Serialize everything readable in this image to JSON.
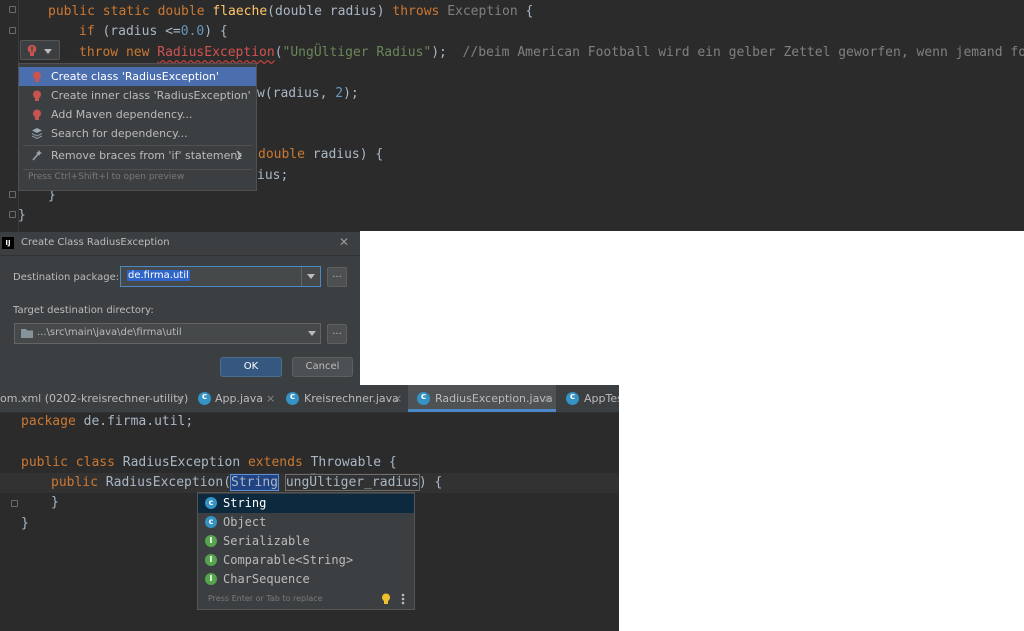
{
  "editor_top": {
    "lines": {
      "l1": {
        "kw1": "public static double ",
        "fn": "flaeche",
        "p1": "(double radius) ",
        "kw2": "throws ",
        "exc": "Exception",
        "p2": " {"
      },
      "l2": {
        "kw": "if",
        "p1": " (radius <=",
        "num": "0.0",
        "p2": ") {"
      },
      "l3": {
        "kw": "throw new ",
        "cls": "RadiusException",
        "p1": "(",
        "str": "\"UngÜltiger Radius\"",
        "p2": ");  ",
        "cmt": "//beim American Football wird ein gelber Zettel geworfen, wenn jemand foult"
      },
      "l4": {
        "p1": "w(radius, ",
        "num": "2",
        "p2": ");"
      },
      "l5": {
        "kw": "double",
        "p1": " radius) {"
      },
      "l6": {
        "p1": "ius;"
      },
      "l7": {
        "p1": "}"
      },
      "l8": {
        "p1": "}"
      }
    },
    "intention_popup": {
      "items": [
        "Create class 'RadiusException'",
        "Create inner class 'RadiusException'",
        "Add Maven dependency...",
        "Search for dependency...",
        "Remove braces from 'if' statement"
      ],
      "hint": "Press Ctrl+Shift+I to open preview"
    }
  },
  "dialog": {
    "app_icon": "IJ",
    "title": "Create Class RadiusException",
    "close": "✕",
    "destination_package_label": "Destination package:",
    "destination_package_value": "de.firma.util",
    "browse": "...",
    "target_dir_label": "Target destination directory:",
    "target_dir_value": "...\\src\\main\\java\\de\\firma\\util",
    "ok": "OK",
    "cancel": "Cancel",
    "accent": "#365880"
  },
  "editor_bottom": {
    "tabs": [
      {
        "label": "om.xml (0202-kreisrechner-utility)"
      },
      {
        "label": "App.java"
      },
      {
        "label": "Kreisrechner.java"
      },
      {
        "label": "RadiusException.java"
      },
      {
        "label": "AppTes"
      }
    ],
    "tab_close": "×",
    "code": {
      "pkg_kw": "package",
      "pkg_name": " de.firma.util;",
      "cls_kw": "public class",
      "cls_name": " RadiusException ",
      "ext_kw": "extends",
      "ext_name": " Throwable {",
      "ctor_kw": "public",
      "ctor_name": " RadiusException(",
      "param_type": "String",
      "param_name": "ungÜltiger_radius",
      "ctor_end": ") {",
      "close1": "}",
      "close2": "}"
    },
    "completion": {
      "items": [
        {
          "label": "String",
          "kind": "class"
        },
        {
          "label": "Object",
          "kind": "class"
        },
        {
          "label": "Serializable",
          "kind": "interface"
        },
        {
          "label": "Comparable<String>",
          "kind": "interface"
        },
        {
          "label": "CharSequence",
          "kind": "interface"
        }
      ],
      "hint": "Press Enter or Tab to replace"
    }
  }
}
